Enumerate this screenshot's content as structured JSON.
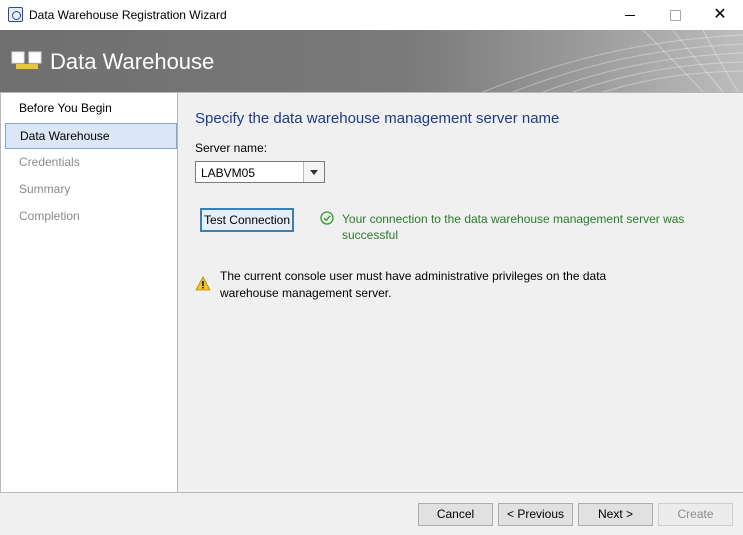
{
  "window": {
    "title": "Data Warehouse Registration Wizard",
    "icons": {
      "app": "wizard-app-icon",
      "minimize": "minimize-icon",
      "maximize": "maximize-icon",
      "close": "close-icon"
    },
    "close_glyph": "✕"
  },
  "banner": {
    "title": "Data Warehouse",
    "icon": "data-warehouse-icon"
  },
  "nav": {
    "items": [
      {
        "label": "Before You Begin",
        "state": "normal"
      },
      {
        "label": "Data Warehouse",
        "state": "selected"
      },
      {
        "label": "Credentials",
        "state": "disabled"
      },
      {
        "label": "Summary",
        "state": "disabled"
      },
      {
        "label": "Completion",
        "state": "disabled"
      }
    ]
  },
  "main": {
    "heading": "Specify the data warehouse management server name",
    "server": {
      "label": "Server name:",
      "value": "LABVM05"
    },
    "test_button": "Test Connection",
    "success_message": "Your connection to the data warehouse management server was successful",
    "warning_message": "The current console user must have administrative privileges on the data warehouse management server."
  },
  "footer": {
    "cancel": "Cancel",
    "previous": "< Previous",
    "next": "Next >",
    "create": "Create"
  },
  "colors": {
    "heading": "#1e3a8a",
    "success": "#2b7a2b",
    "selection": "#dbe7f6",
    "banner": "#7a7a7a"
  }
}
